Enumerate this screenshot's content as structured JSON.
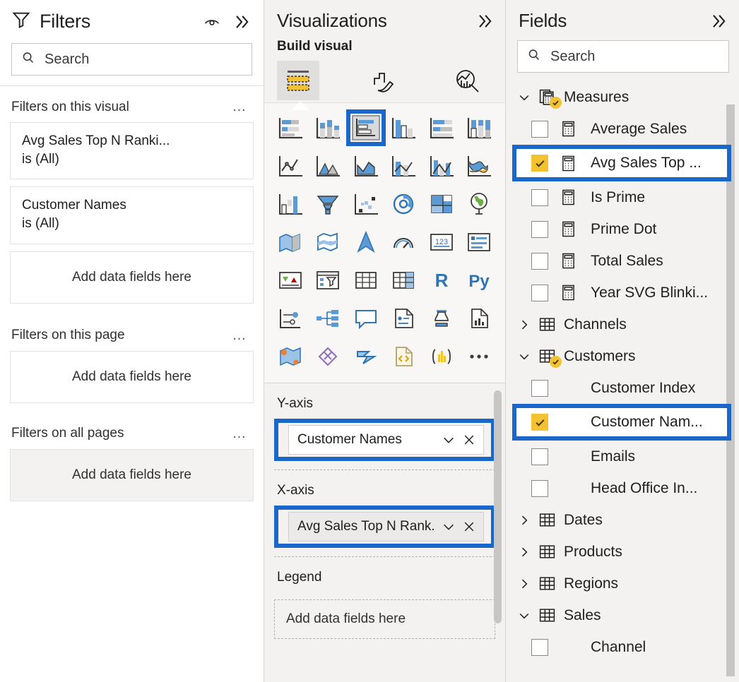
{
  "filters": {
    "title": "Filters",
    "eye_icon": "eye-icon",
    "collapse_icon": "double-chevron-right-icon",
    "search": {
      "placeholder": "Search",
      "value": "",
      "icon": "search-icon"
    },
    "groups": [
      {
        "title": "Filters on this visual",
        "menu": "…",
        "cards": [
          {
            "field": "Avg Sales Top N Ranki...",
            "condition": "is (All)"
          },
          {
            "field": "Customer Names",
            "condition": "is (All)"
          }
        ],
        "dropzone": "Add data fields here",
        "dropzone_shaded": false
      },
      {
        "title": "Filters on this page",
        "menu": "…",
        "cards": [],
        "dropzone": "Add data fields here",
        "dropzone_shaded": false
      },
      {
        "title": "Filters on all pages",
        "menu": "…",
        "cards": [],
        "dropzone": "Add data fields here",
        "dropzone_shaded": true
      }
    ]
  },
  "visualizations": {
    "title": "Visualizations",
    "collapse_icon": "double-chevron-right-icon",
    "build_label": "Build visual",
    "tabs": [
      {
        "name": "build-visual-tab",
        "icon": "fields-bars-icon",
        "active": true
      },
      {
        "name": "format-visual-tab",
        "icon": "paint-brush-icon",
        "active": false
      },
      {
        "name": "analytics-tab",
        "icon": "magnifier-chart-icon",
        "active": false
      }
    ],
    "gallery": [
      {
        "icon": "stacked-bar-chart-icon",
        "selected": false
      },
      {
        "icon": "stacked-column-chart-icon",
        "selected": false
      },
      {
        "icon": "clustered-bar-chart-icon",
        "selected": true
      },
      {
        "icon": "clustered-column-chart-icon",
        "selected": false
      },
      {
        "icon": "100-stacked-bar-chart-icon",
        "selected": false
      },
      {
        "icon": "100-stacked-column-chart-icon",
        "selected": false
      },
      {
        "icon": "line-chart-icon",
        "selected": false
      },
      {
        "icon": "area-chart-icon",
        "selected": false
      },
      {
        "icon": "stacked-area-chart-icon",
        "selected": false
      },
      {
        "icon": "line-stacked-column-chart-icon",
        "selected": false
      },
      {
        "icon": "line-clustered-column-chart-icon",
        "selected": false
      },
      {
        "icon": "ribbon-chart-icon",
        "selected": false
      },
      {
        "icon": "waterfall-chart-icon",
        "selected": false
      },
      {
        "icon": "funnel-chart-icon",
        "selected": false
      },
      {
        "icon": "scatter-chart-icon",
        "selected": false
      },
      {
        "icon": "pie-chart-icon",
        "selected": false
      },
      {
        "icon": "treemap-icon",
        "selected": false
      },
      {
        "icon": "map-icon",
        "selected": false
      },
      {
        "icon": "filled-map-icon",
        "selected": false
      },
      {
        "icon": "shape-map-icon",
        "selected": false
      },
      {
        "icon": "azure-map-icon",
        "selected": false
      },
      {
        "icon": "gauge-icon",
        "selected": false
      },
      {
        "icon": "card-icon",
        "selected": false
      },
      {
        "icon": "multi-row-card-icon",
        "selected": false
      },
      {
        "icon": "kpi-icon",
        "selected": false
      },
      {
        "icon": "slicer-icon",
        "selected": false
      },
      {
        "icon": "table-icon",
        "selected": false
      },
      {
        "icon": "matrix-icon",
        "selected": false
      },
      {
        "icon": "r-script-visual-icon",
        "selected": false
      },
      {
        "icon": "python-visual-icon",
        "selected": false
      },
      {
        "icon": "key-influencers-icon",
        "selected": false
      },
      {
        "icon": "decomposition-tree-icon",
        "selected": false
      },
      {
        "icon": "smart-narrative-icon",
        "selected": false
      },
      {
        "icon": "metrics-icon",
        "selected": false
      },
      {
        "icon": "paginated-report-icon",
        "selected": false
      },
      {
        "icon": "power-apps-icon",
        "selected": false
      },
      {
        "icon": "arcgis-map-icon",
        "selected": false
      },
      {
        "icon": "powerapps-diamond-icon",
        "selected": false
      },
      {
        "icon": "power-automate-icon",
        "selected": false
      },
      {
        "icon": "html-content-icon",
        "selected": false
      },
      {
        "icon": "deneb-icon",
        "selected": false
      },
      {
        "icon": "more-visuals-icon",
        "selected": false
      }
    ],
    "wells": [
      {
        "label": "Y-axis",
        "name": "y-axis-well",
        "chip": "Customer Names",
        "chip_gray": false,
        "highlighted": true,
        "dropdown_icon": "chevron-down-icon",
        "remove_icon": "close-icon"
      },
      {
        "label": "X-axis",
        "name": "x-axis-well",
        "chip": "Avg Sales Top N Rank...",
        "chip_gray": true,
        "highlighted": true,
        "dropdown_icon": "chevron-down-icon",
        "remove_icon": "close-icon"
      },
      {
        "label": "Legend",
        "name": "legend-well",
        "chip": "Add data fields here",
        "chip_gray": false,
        "highlighted": false,
        "empty": true
      }
    ]
  },
  "fields": {
    "title": "Fields",
    "collapse_icon": "double-chevron-right-icon",
    "search": {
      "placeholder": "Search",
      "value": "",
      "icon": "search-icon"
    },
    "tree": [
      {
        "name": "Measures",
        "expanded": true,
        "icon": "measures-table-icon",
        "has_badge": true,
        "children": [
          {
            "name": "Average Sales",
            "checked": false,
            "icon": "measure-icon"
          },
          {
            "name": "Avg Sales Top ...",
            "checked": true,
            "icon": "measure-icon",
            "highlighted": true
          },
          {
            "name": "Is Prime",
            "checked": false,
            "icon": "measure-icon"
          },
          {
            "name": "Prime Dot",
            "checked": false,
            "icon": "measure-icon"
          },
          {
            "name": "Total Sales",
            "checked": false,
            "icon": "measure-icon"
          },
          {
            "name": "Year SVG Blinki...",
            "checked": false,
            "icon": "measure-icon"
          }
        ]
      },
      {
        "name": "Channels",
        "expanded": false,
        "icon": "table-icon",
        "has_badge": false,
        "children": []
      },
      {
        "name": "Customers",
        "expanded": true,
        "icon": "table-icon",
        "has_badge": true,
        "children": [
          {
            "name": "Customer Index",
            "checked": false
          },
          {
            "name": "Customer Nam...",
            "checked": true,
            "highlighted": true
          },
          {
            "name": "Emails",
            "checked": false
          },
          {
            "name": "Head Office In...",
            "checked": false
          }
        ]
      },
      {
        "name": "Dates",
        "expanded": false,
        "icon": "table-icon",
        "has_badge": false,
        "children": []
      },
      {
        "name": "Products",
        "expanded": false,
        "icon": "table-icon",
        "has_badge": false,
        "children": []
      },
      {
        "name": "Regions",
        "expanded": false,
        "icon": "table-icon",
        "has_badge": false,
        "children": []
      },
      {
        "name": "Sales",
        "expanded": true,
        "icon": "table-icon",
        "has_badge": false,
        "children": [
          {
            "name": "Channel",
            "checked": false
          }
        ]
      }
    ]
  },
  "colors": {
    "highlight_blue": "#1b66c9",
    "checkbox_yellow": "#f2c230",
    "panel_bg": "#f3f2f1",
    "white": "#ffffff"
  }
}
